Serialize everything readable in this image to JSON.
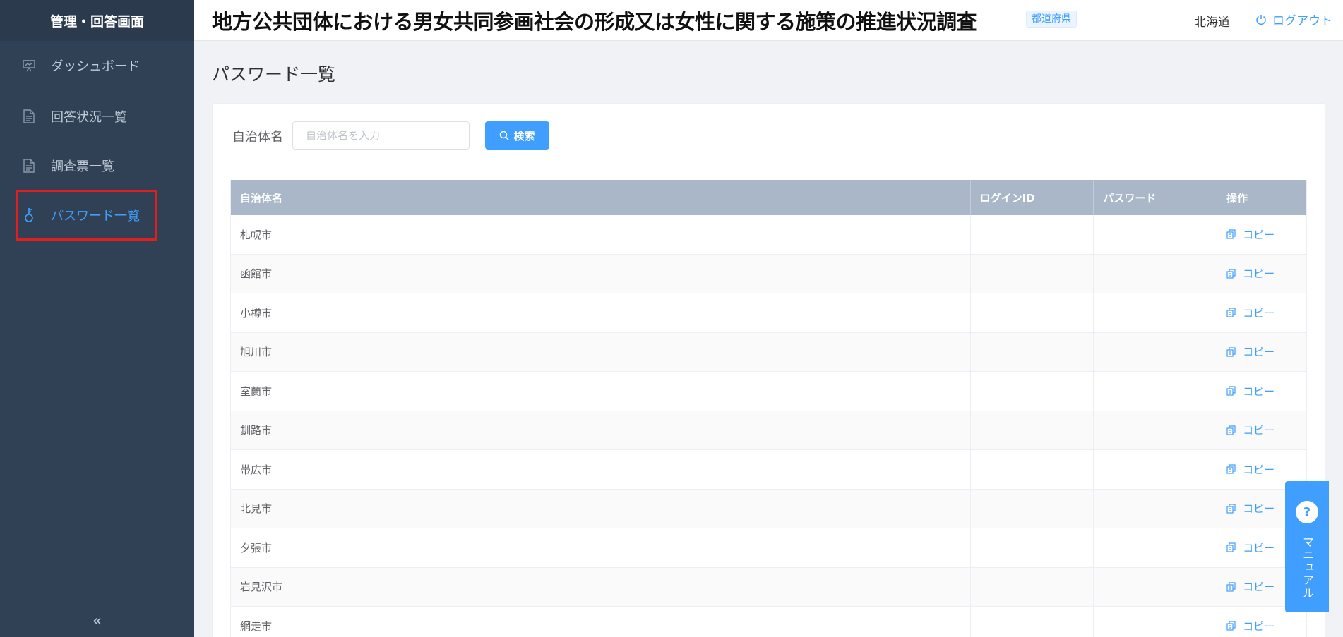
{
  "sidebar": {
    "title": "管理・回答画面",
    "items": [
      {
        "label": "ダッシュボード",
        "icon": "presentation-icon"
      },
      {
        "label": "回答状況一覧",
        "icon": "document-icon"
      },
      {
        "label": "調査票一覧",
        "icon": "document-icon"
      },
      {
        "label": "パスワード一覧",
        "icon": "key-icon",
        "active": true
      }
    ],
    "collapse_glyph": "«"
  },
  "header": {
    "title": "地方公共団体における男女共同参画社会の形成又は女性に関する施策の推進状況調査",
    "tag": "都道府県",
    "user": "北海道",
    "logout": "ログアウト"
  },
  "page": {
    "title": "パスワード一覧"
  },
  "search": {
    "label": "自治体名",
    "placeholder": "自治体名を入力",
    "button": "検索"
  },
  "table": {
    "columns": [
      "自治体名",
      "ログインID",
      "パスワード",
      "操作"
    ],
    "action_label": "コピー",
    "rows": [
      {
        "name": "札幌市",
        "login_id": "",
        "password": ""
      },
      {
        "name": "函館市",
        "login_id": "",
        "password": ""
      },
      {
        "name": "小樽市",
        "login_id": "",
        "password": ""
      },
      {
        "name": "旭川市",
        "login_id": "",
        "password": ""
      },
      {
        "name": "室蘭市",
        "login_id": "",
        "password": ""
      },
      {
        "name": "釧路市",
        "login_id": "",
        "password": ""
      },
      {
        "name": "帯広市",
        "login_id": "",
        "password": ""
      },
      {
        "name": "北見市",
        "login_id": "",
        "password": ""
      },
      {
        "name": "夕張市",
        "login_id": "",
        "password": ""
      },
      {
        "name": "岩見沢市",
        "login_id": "",
        "password": ""
      },
      {
        "name": "網走市",
        "login_id": "",
        "password": ""
      }
    ]
  },
  "manual": {
    "glyph": "?",
    "label": "マニュアル"
  },
  "colors": {
    "sidebar_bg": "#304156",
    "accent": "#409eff",
    "table_header_bg": "#a9b7c8",
    "highlight_border": "#e01e1e"
  }
}
